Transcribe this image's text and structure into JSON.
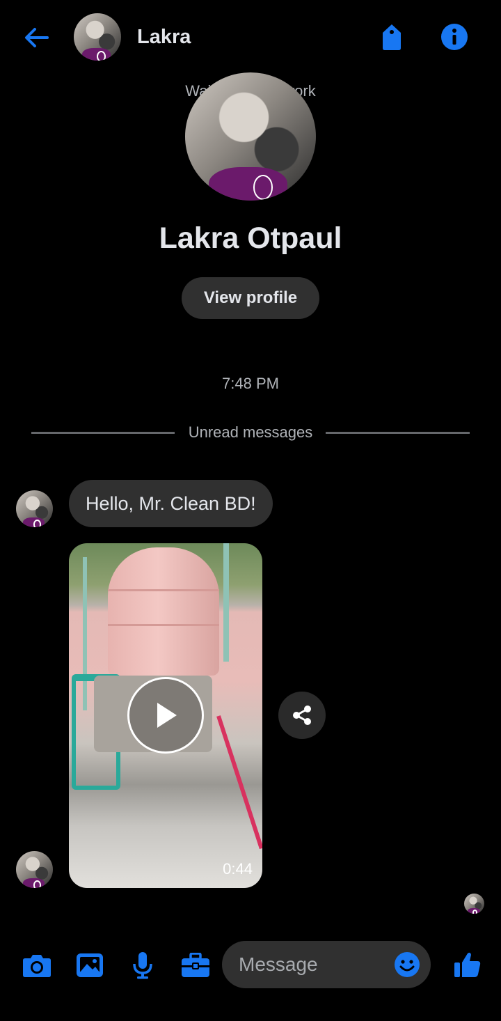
{
  "header": {
    "contact_name": "Lakra",
    "status": "Waiting for network"
  },
  "profile": {
    "full_name": "Lakra Otpaul",
    "view_profile_label": "View profile"
  },
  "timeline": {
    "timestamp": "7:48 PM",
    "unread_label": "Unread messages"
  },
  "messages": [
    {
      "text": "Hello, Mr. Clean BD!"
    },
    {
      "video_duration": "0:44"
    }
  ],
  "composer": {
    "placeholder": "Message"
  },
  "icons": {
    "back": "back-arrow-icon",
    "tag": "tag-icon",
    "info": "info-icon",
    "share": "share-icon",
    "play": "play-icon",
    "camera": "camera-icon",
    "gallery": "image-icon",
    "mic": "microphone-icon",
    "briefcase": "briefcase-icon",
    "emoji": "emoji-icon",
    "like": "thumbs-up-icon"
  },
  "colors": {
    "accent": "#1877f2",
    "bubble": "#303030",
    "background": "#000000"
  }
}
